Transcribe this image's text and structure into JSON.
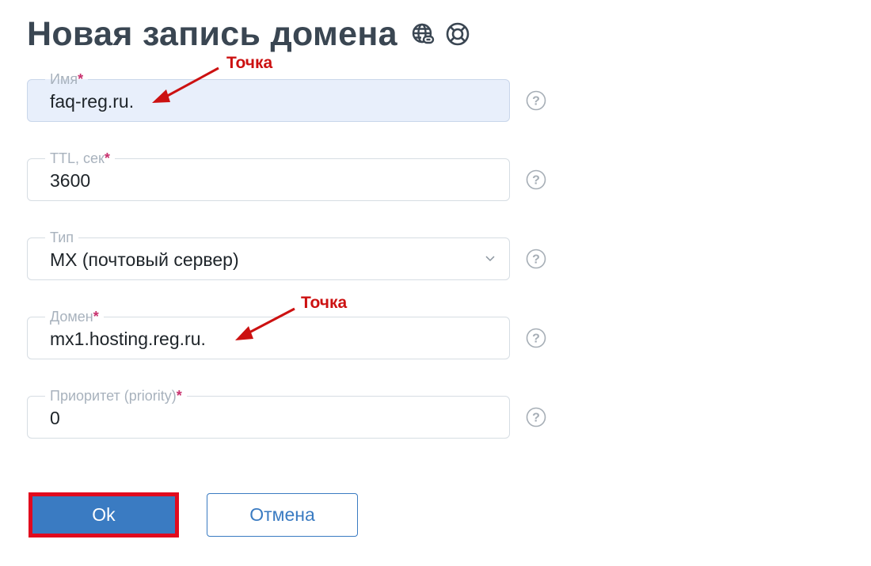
{
  "title": "Новая запись домена",
  "title_icons": [
    "globe-link-icon",
    "lifebuoy-icon"
  ],
  "fields": [
    {
      "label": "Имя",
      "required": "*",
      "value": "faq-reg.ru."
    },
    {
      "label": "TTL, сек",
      "required": "*",
      "value": "3600"
    },
    {
      "label": "Тип",
      "required": "",
      "value": "MX (почтовый сервер)"
    },
    {
      "label": "Домен",
      "required": "*",
      "value": "mx1.hosting.reg.ru."
    },
    {
      "label": "Приоритет (priority)",
      "required": "*",
      "value": "0"
    }
  ],
  "annotations": [
    "Точка",
    "Точка"
  ],
  "buttons": {
    "ok": "Ok",
    "cancel": "Отмена"
  },
  "colors": {
    "title": "#3a4652",
    "required": "#c8316e",
    "annotation": "#cc1111",
    "primary": "#3a7bc2",
    "highlight_border": "#e10a1e",
    "filled_field_bg": "#e8effb"
  }
}
